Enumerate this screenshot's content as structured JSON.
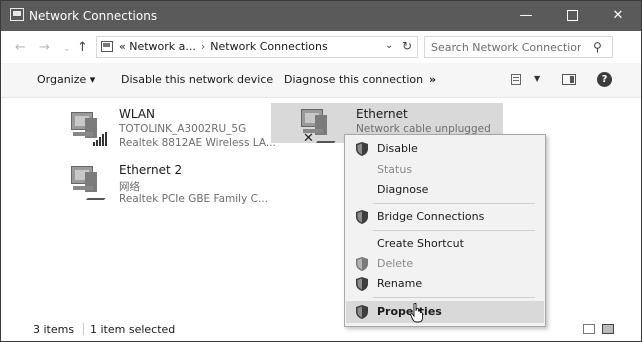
{
  "window": {
    "title": "Network Connections",
    "controls": {
      "minimize": "—",
      "maximize": "",
      "close": "✕"
    }
  },
  "nav": {
    "back": "←",
    "forward": "→",
    "recent": "⌄",
    "up": "↑",
    "address": {
      "prefix": "«",
      "crumb1": "Network a...",
      "separator": "›",
      "crumb2": "Network Connections"
    },
    "dropdown": "⌄",
    "refresh": "↻",
    "search": {
      "placeholder": "Search Network Connections",
      "icon": "search-icon"
    }
  },
  "toolbar": {
    "organize": "Organize ▾",
    "disable_device": "Disable this network device",
    "diagnose": "Diagnose this connection",
    "more": "»",
    "view_dropdown": "▼",
    "help": "?"
  },
  "connections": [
    {
      "name": "WLAN",
      "line1": "TOTOLINK_A3002RU_5G",
      "line2": "Realtek 8812AE Wireless LA...",
      "icon": "wireless-network-icon"
    },
    {
      "name": "Ethernet",
      "line1": "Network cable unplugged",
      "icon": "ethernet-network-icon",
      "status_mark": "✕"
    },
    {
      "name": "Ethernet 2",
      "line1": "网络",
      "line2": "Realtek PCIe GBE Family C...",
      "icon": "ethernet-network-icon"
    }
  ],
  "context_menu": {
    "items": [
      {
        "label": "Disable",
        "shield": true,
        "enabled": true
      },
      {
        "label": "Status",
        "shield": false,
        "enabled": false
      },
      {
        "label": "Diagnose",
        "shield": false,
        "enabled": true
      },
      {
        "label": "Bridge Connections",
        "shield": true,
        "enabled": true
      },
      {
        "label": "Create Shortcut",
        "shield": false,
        "enabled": true
      },
      {
        "label": "Delete",
        "shield": true,
        "enabled": false
      },
      {
        "label": "Rename",
        "shield": true,
        "enabled": true
      },
      {
        "label": "Properties",
        "shield": true,
        "enabled": true,
        "bold": true,
        "highlighted": true
      }
    ]
  },
  "status": {
    "items_count": "3 items",
    "selected": "1 item selected"
  },
  "colors": {
    "titlebar": "#5a5a5a",
    "selection": "#d9d9d9",
    "menu_bg": "#f2f2f2",
    "disabled_text": "#8a8a8a"
  }
}
